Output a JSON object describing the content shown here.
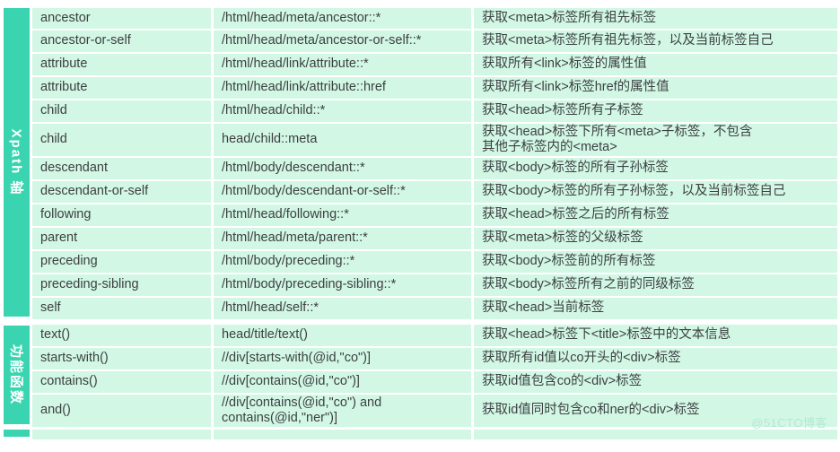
{
  "watermark": "@51CTO博客",
  "colors": {
    "rail_bg": "#3ad5b0",
    "cell_bg": "#d2f7e4",
    "gridline": "#ffffff",
    "text": "#3c4043",
    "watermark_text": "#b6e8d3"
  },
  "columns": {
    "category": "",
    "name": "",
    "expression": "",
    "description": ""
  },
  "sections": [
    {
      "label": "Xpath 轴",
      "rows": [
        {
          "name": "ancestor",
          "expression": "/html/head/meta/ancestor::*",
          "description": "获取<meta>标签所有祖先标签",
          "tall": false
        },
        {
          "name": "ancestor-or-self",
          "expression": "/html/head/meta/ancestor-or-self::*",
          "description": "获取<meta>标签所有祖先标签，以及当前标签自己",
          "tall": false
        },
        {
          "name": "attribute",
          "expression": "/html/head/link/attribute::*",
          "description": "获取所有<link>标签的属性值",
          "tall": false
        },
        {
          "name": "attribute",
          "expression": "/html/head/link/attribute::href",
          "description": "获取所有<link>标签href的属性值",
          "tall": false
        },
        {
          "name": "child",
          "expression": "/html/head/child::*",
          "description": "获取<head>标签所有子标签",
          "tall": false
        },
        {
          "name": "child",
          "expression": "head/child::meta",
          "description": "获取<head>标签下所有<meta>子标签，不包含\n其他子标签内的<meta>",
          "tall": true
        },
        {
          "name": "descendant",
          "expression": "/html/body/descendant::*",
          "description": "获取<body>标签的所有子孙标签",
          "tall": false
        },
        {
          "name": "descendant-or-self",
          "expression": "/html/body/descendant-or-self::*",
          "description": "获取<body>标签的所有子孙标签，以及当前标签自己",
          "tall": false
        },
        {
          "name": "following",
          "expression": "/html/head/following::*",
          "description": "获取<head>标签之后的所有标签",
          "tall": false
        },
        {
          "name": "parent",
          "expression": "/html/head/meta/parent::*",
          "description": "获取<meta>标签的父级标签",
          "tall": false
        },
        {
          "name": "preceding",
          "expression": "/html/body/preceding::*",
          "description": "获取<body>标签前的所有标签",
          "tall": false
        },
        {
          "name": "preceding-sibling",
          "expression": "/html/body/preceding-sibling::*",
          "description": "获取<body>标签所有之前的同级标签",
          "tall": false
        },
        {
          "name": "self",
          "expression": "/html/head/self::*",
          "description": "获取<head>当前标签",
          "tall": false
        }
      ]
    },
    {
      "label": "功能函数",
      "rows": [
        {
          "name": "text()",
          "expression": "head/title/text()",
          "description": "获取<head>标签下<title>标签中的文本信息",
          "tall": false
        },
        {
          "name": "starts-with()",
          "expression": "//div[starts-with(@id,\"co\")]",
          "description": "获取所有id值以co开头的<div>标签",
          "tall": false
        },
        {
          "name": "contains()",
          "expression": "//div[contains(@id,\"co\")]",
          "description": "获取id值包含co的<div>标签",
          "tall": false
        },
        {
          "name": "and()",
          "expression": "//div[contains(@id,\"co\") and\ncontains(@id,\"ner\")]",
          "description": "获取id值同时包含co和ner的<div>标签",
          "tall": true
        }
      ]
    }
  ]
}
